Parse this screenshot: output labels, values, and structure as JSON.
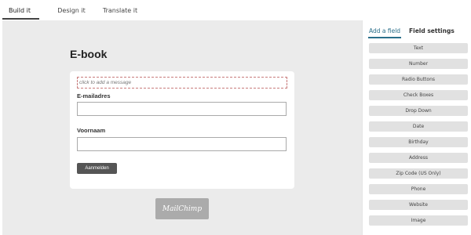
{
  "top_tabs": [
    {
      "label": "Build it",
      "active": true
    },
    {
      "label": "Design it",
      "active": false
    },
    {
      "label": "Translate it",
      "active": false
    }
  ],
  "form": {
    "title": "E-book",
    "message_placeholder": "click to add a message",
    "fields": [
      {
        "label": "E-mailadres",
        "value": ""
      },
      {
        "label": "Voornaam",
        "value": ""
      }
    ],
    "submit_label": "Aanmelden",
    "badge_text": "MailChimp"
  },
  "side_panel": {
    "tabs": [
      {
        "label": "Add a field",
        "active": true
      },
      {
        "label": "Field settings",
        "active": false
      }
    ],
    "field_types": [
      "Text",
      "Number",
      "Radio Buttons",
      "Check Boxes",
      "Drop Down",
      "Date",
      "Birthday",
      "Address",
      "Zip Code (US Only)",
      "Phone",
      "Website",
      "Image"
    ]
  }
}
